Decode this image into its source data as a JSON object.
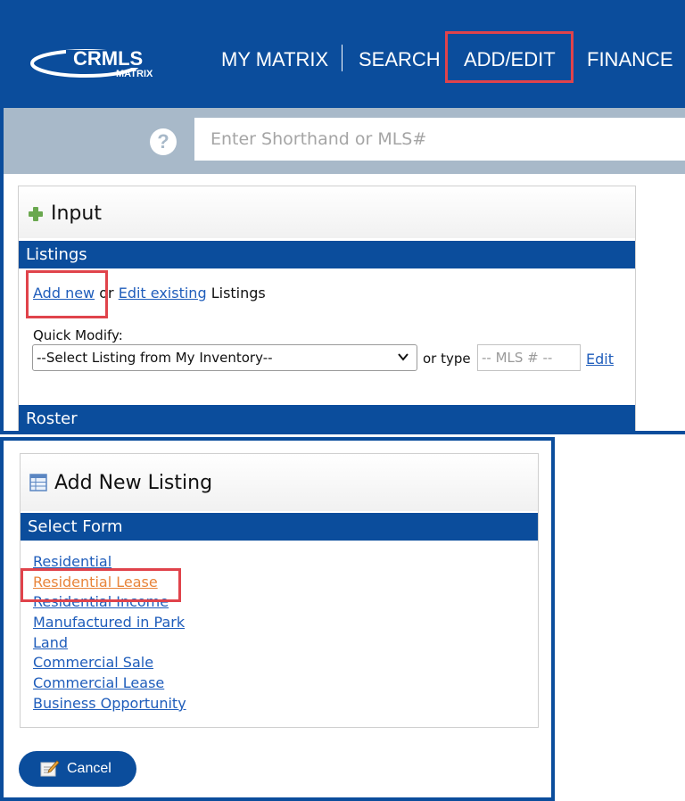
{
  "brand": {
    "logo_text": "CRMLS",
    "logo_sub": "MATRIX",
    "primary_color": "#0b4d9c",
    "highlight_color": "#e0434b",
    "visited_link_color": "#e8843a"
  },
  "nav": {
    "items": [
      {
        "label": "MY MATRIX"
      },
      {
        "label": "SEARCH"
      },
      {
        "label": "ADD/EDIT",
        "highlighted": true
      },
      {
        "label": "FINANCE"
      }
    ]
  },
  "search": {
    "help_glyph": "?",
    "placeholder": "Enter Shorthand or MLS#"
  },
  "input_panel": {
    "title": "Input",
    "listings": {
      "section_label": "Listings",
      "add_new": "Add new",
      "or": "or",
      "edit_existing": "Edit existing",
      "suffix": "Listings",
      "quick_modify_label": "Quick Modify:",
      "select_value": "--Select Listing from My Inventory--",
      "or_type": "or type",
      "mls_placeholder": "-- MLS # --",
      "edit_label": "Edit"
    },
    "roster": {
      "section_label": "Roster"
    }
  },
  "add_new_listing": {
    "title": "Add New Listing",
    "section_label": "Select Form",
    "forms": [
      {
        "label": "Residential"
      },
      {
        "label": "Residential Lease",
        "active": true
      },
      {
        "label": "Residential Income"
      },
      {
        "label": "Manufactured in Park"
      },
      {
        "label": "Land"
      },
      {
        "label": "Commercial Sale"
      },
      {
        "label": "Commercial Lease"
      },
      {
        "label": "Business Opportunity"
      }
    ],
    "cancel_label": "Cancel"
  }
}
